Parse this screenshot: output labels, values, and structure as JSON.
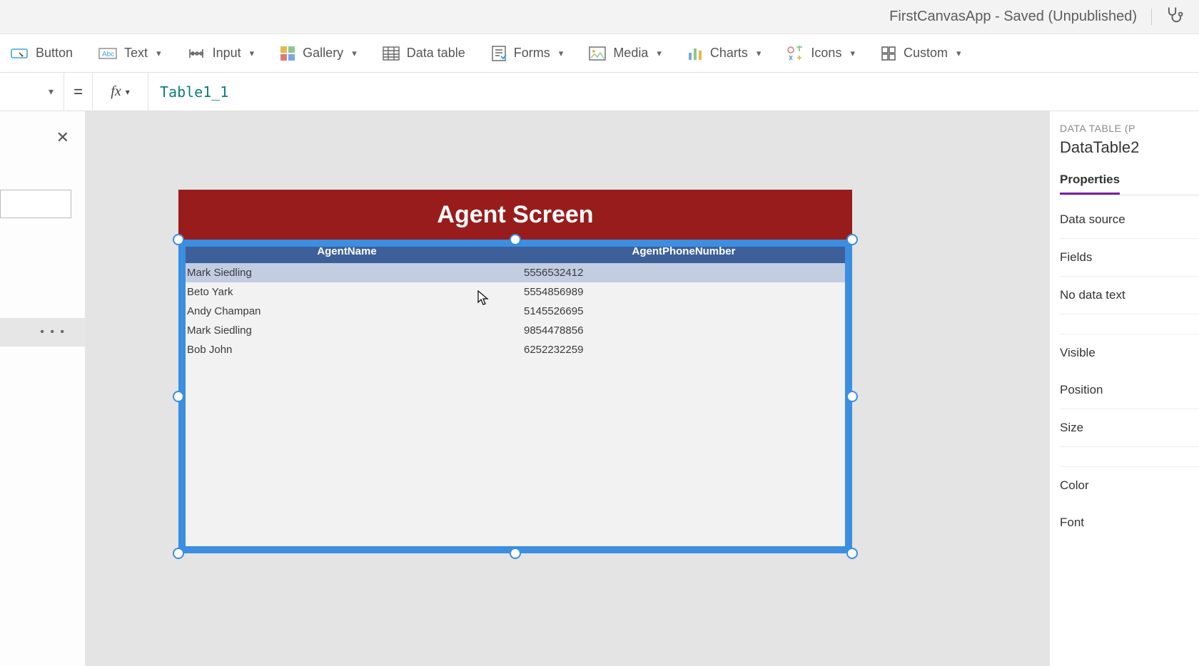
{
  "titleBar": {
    "appTitle": "FirstCanvasApp - Saved (Unpublished)"
  },
  "ribbon": {
    "button": "Button",
    "text": "Text",
    "input": "Input",
    "gallery": "Gallery",
    "dataTable": "Data table",
    "forms": "Forms",
    "media": "Media",
    "charts": "Charts",
    "icons": "Icons",
    "custom": "Custom"
  },
  "formulaBar": {
    "eq": "=",
    "fx": "fx",
    "value": "Table1_1"
  },
  "leftPanel": {
    "ellipsis": "•  •  •"
  },
  "canvas": {
    "screenTitle": "Agent Screen",
    "table": {
      "columns": [
        "AgentName",
        "AgentPhoneNumber"
      ],
      "rows": [
        {
          "name": "Mark Siedling",
          "phone": "5556532412",
          "selected": true
        },
        {
          "name": "Beto Yark",
          "phone": "5554856989",
          "selected": false
        },
        {
          "name": "Andy Champan",
          "phone": "5145526695",
          "selected": false
        },
        {
          "name": "Mark Siedling",
          "phone": "9854478856",
          "selected": false
        },
        {
          "name": "Bob John",
          "phone": "6252232259",
          "selected": false
        }
      ]
    }
  },
  "rightPanel": {
    "typeLabel": "DATA TABLE (P",
    "objectName": "DataTable2",
    "tabProperties": "Properties",
    "props": {
      "dataSource": "Data source",
      "fields": "Fields",
      "noDataText": "No data text",
      "visible": "Visible",
      "position": "Position",
      "size": "Size",
      "color": "Color",
      "font": "Font"
    }
  }
}
